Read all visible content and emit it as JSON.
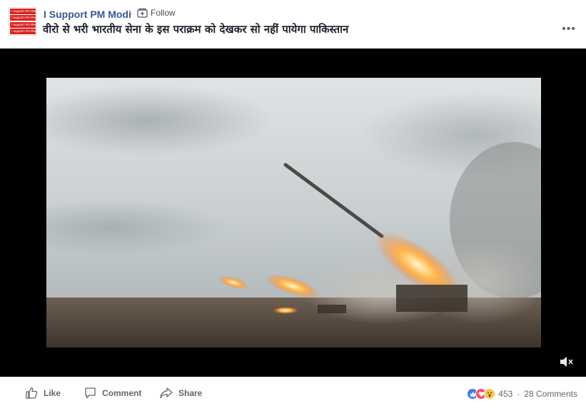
{
  "header": {
    "page_name": "I Support PM Modi",
    "separator": "·",
    "follow_label": "Follow",
    "post_text": "वीरो से भरी भारतीय सेना के इस पराक्रम को देखकर सो नहीं पायेगा पाकिस्तान",
    "more_menu": "•••",
    "avatar_strip_text": "I Support Pm Modi"
  },
  "video": {
    "muted": true,
    "mute_icon": "speaker-muted-icon"
  },
  "actions": {
    "like_label": "Like",
    "comment_label": "Comment",
    "share_label": "Share"
  },
  "reactions": {
    "types": [
      "like-icon",
      "love-icon",
      "wow-icon"
    ],
    "count": "453",
    "separator": "·",
    "comments_count": "28 Comments"
  },
  "colors": {
    "link_blue": "#365899",
    "action_gray": "#606770",
    "avatar_red": "#d8231f"
  }
}
